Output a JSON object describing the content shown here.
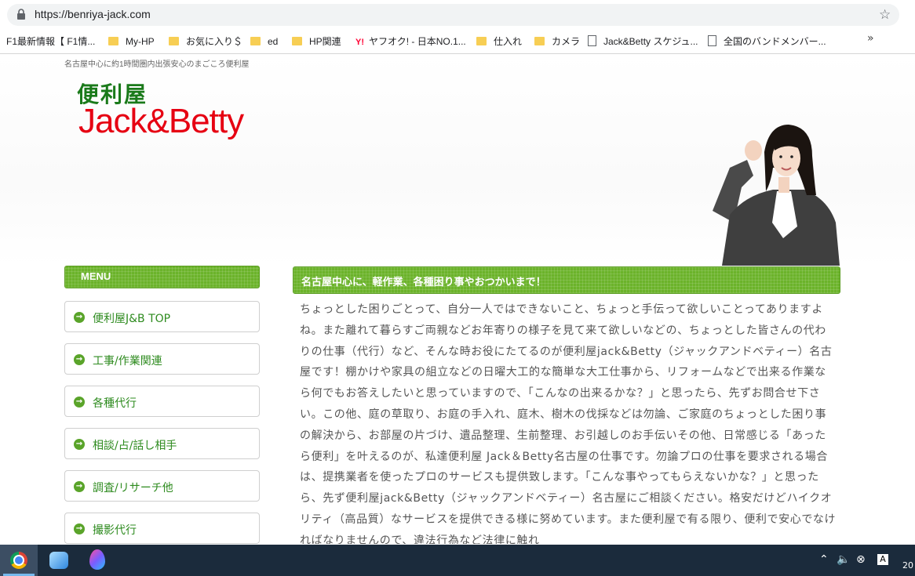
{
  "browser": {
    "url": "https://benriya-jack.com",
    "bookmarks": [
      {
        "label": "F1最新情報【 F1情...",
        "icon": "none"
      },
      {
        "label": "My-HP",
        "icon": "folder-icon"
      },
      {
        "label": "お気に入り＄",
        "icon": "folder-icon"
      },
      {
        "label": "ed",
        "icon": "folder-icon"
      },
      {
        "label": "HP関連",
        "icon": "folder-icon"
      },
      {
        "label": "ヤフオク! - 日本NO.1...",
        "icon": "yahoo-icon"
      },
      {
        "label": "仕入れ",
        "icon": "folder-icon"
      },
      {
        "label": "カメラ",
        "icon": "folder-icon"
      },
      {
        "label": "Jack&Betty スケジュ...",
        "icon": "doc-icon"
      },
      {
        "label": "全国のバンドメンバー...",
        "icon": "doc-icon"
      }
    ],
    "more": "»"
  },
  "site": {
    "tagline": "名古屋中心に約1時間圏内出張安心のまごころ便利屋",
    "logo_top": "便利屋",
    "logo_main": "Jack&Betty"
  },
  "sidebar": {
    "header": "MENU",
    "items": [
      {
        "label": "便利屋J&B TOP"
      },
      {
        "label": "工事/作業関連"
      },
      {
        "label": "各種代行"
      },
      {
        "label": "相談/占/話し相手"
      },
      {
        "label": "調査/リサーチ他"
      },
      {
        "label": "撮影代行"
      }
    ]
  },
  "main": {
    "heading": "名古屋中心に、軽作業、各種困り事やおつかいまで！",
    "body": "ちょっとした困りごとって、自分一人ではできないこと、ちょっと手伝って欲しいことってありますよね。また離れて暮らすご両親などお年寄りの様子を見て来て欲しいなどの、ちょっとした皆さんの代わりの仕事（代行）など、そんな時お役にたてるのが便利屋jack&Betty（ジャックアンドベティー）名古屋です！棚かけや家具の組立などの日曜大工的な簡単な大工仕事から、リフォームなどで出来る作業なら何でもお答えしたいと思っていますので、「こんなの出来るかな？」と思ったら、先ずお問合せ下さい。この他、庭の草取り、お庭の手入れ、庭木、樹木の伐採などは勿論、ご家庭のちょっとした困り事の解決から、お部屋の片づけ、遺品整理、生前整理、お引越しのお手伝いその他、日常感じる「あったら便利」を叶えるのが、私達便利屋 Jack＆Betty名古屋の仕事です。勿論プロの仕事を要求される場合は、提携業者を使ったプロのサービスも提供致します。「こんな事やってもらえないかな？」と思ったら、先ず便利屋jack&Betty（ジャックアンドベティー）名古屋にご相談ください。格安だけどハイクオリティ（高品質）なサービスを提供できる様に努めています。また便利屋で有る限り、便利で安心でなければなりませんので、違法行為など法律に触れ"
  },
  "taskbar": {
    "clock": "20"
  },
  "colors": {
    "accent_green": "#6bb32a",
    "logo_red": "#e60012",
    "logo_green": "#1a7a1a",
    "link_green": "#2e8b1f"
  }
}
